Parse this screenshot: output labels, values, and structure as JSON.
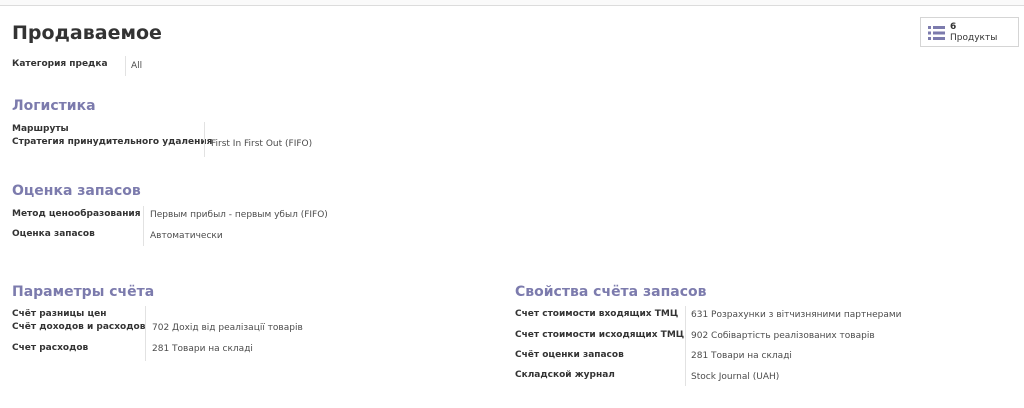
{
  "page": {
    "title": "Продаваемое"
  },
  "smart_button": {
    "count": "6",
    "label": "Продукты",
    "icon": "list-icon",
    "accent": "#7c7bad"
  },
  "parent_category": {
    "label": "Категория предка",
    "value": "All"
  },
  "logistics": {
    "title": "Логистика",
    "routes_label": "Маршруты",
    "removal_label": "Стратегия принудительного удаления",
    "removal_value": "First In First Out (FIFO)"
  },
  "valuation": {
    "title": "Оценка запасов",
    "costing_label": "Метод ценообразования",
    "costing_value": "Первым прибыл - первым убыл (FIFO)",
    "inventory_label": "Оценка запасов",
    "inventory_value": "Автоматически"
  },
  "account_params": {
    "title": "Параметры счёта",
    "price_diff_label": "Счёт разницы цен",
    "income_label": "Счёт доходов и расходов",
    "income_value": "702 Дохід від реалізації товарів",
    "expense_label": "Счет расходов",
    "expense_value": "281 Товари на складі"
  },
  "stock_props": {
    "title": "Свойства счёта запасов",
    "input_label": "Счет стоимости входящих ТМЦ",
    "input_value": "631 Розрахунки з вітчизняними партнерами",
    "output_label": "Счет стоимости исходящих ТМЦ",
    "output_value": "902 Собівартість реалізованих товарів",
    "valuation_label": "Счёт оценки запасов",
    "valuation_value": "281 Товари на складі",
    "journal_label": "Складской журнал",
    "journal_value": "Stock Journal (UAH)"
  }
}
